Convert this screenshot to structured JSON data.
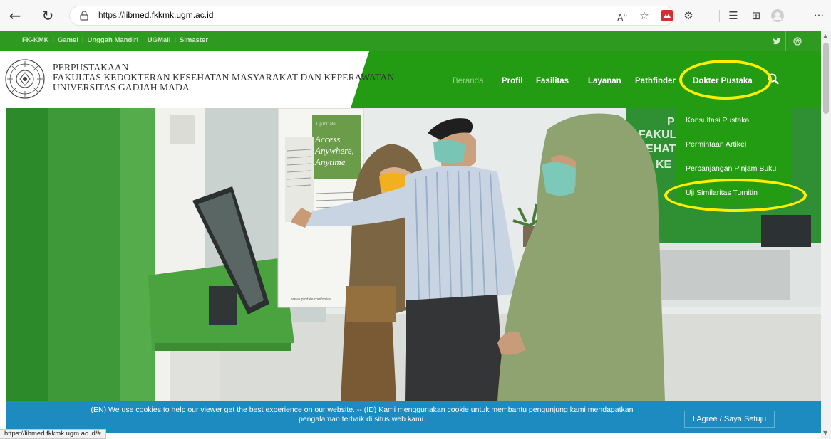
{
  "browser": {
    "url_prefix": "https://",
    "url_host": "libmed.fkkmk.ugm.ac.id",
    "more_label": "···",
    "status_url": "https://libmed.fkkmk.ugm.ac.id/#"
  },
  "top_links": [
    "FK-KMK",
    "Gamel",
    "Unggah Mandiri",
    "UGMail",
    "Simaster"
  ],
  "brand": {
    "line1": "PERPUSTAKAAN",
    "line2": "FAKULTAS KEDOKTERAN KESEHATAN MASYARAKAT DAN KEPERAWATAN",
    "line3": "UNIVERSITAS GADJAH MADA"
  },
  "menu": {
    "beranda": "Beranda",
    "profil": "Profil",
    "fasilitas": "Fasilitas",
    "layanan": "Layanan",
    "pathfinder": "Pathfinder",
    "dokter_pustaka": "Dokter Pustaka"
  },
  "dropdown": [
    "Konsultasi Pustaka",
    "Permintaan Artikel",
    "Perpanjangan Pinjam Buku",
    "Uji Similaritas Turnitin"
  ],
  "hero_texts": {
    "banner_line1": "Access",
    "banner_line2": "Anywhere,",
    "banner_line3": "Anytime",
    "banner_url": "www.uptodate.com/online",
    "banner_brand": "UpToDate",
    "wall_text1": "FAKULT",
    "wall_text2": "EHAT",
    "wall_text3": "KE",
    "wall_text0": "P"
  },
  "cookie": {
    "line1": "(EN) We use cookies to help our viewer get the best experience on our website. -- (ID) Kami menggunakan cookie untuk membantu pengunjung kami mendapatkan",
    "line2": "pengalaman terbaik di situs web kami.",
    "agree": "I Agree / Saya Setuju"
  },
  "colors": {
    "header_green": "#239b12",
    "top_strip": "#2e9a1f",
    "cookie_blue": "#1d8bbf",
    "annotation_yellow": "#ffee00"
  }
}
